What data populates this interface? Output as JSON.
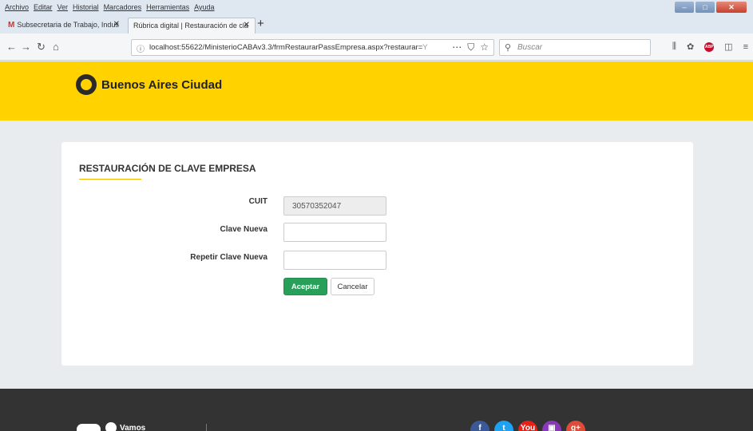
{
  "browser": {
    "menu": [
      "Archivo",
      "Editar",
      "Ver",
      "Historial",
      "Marcadores",
      "Herramientas",
      "Ayuda"
    ],
    "tabs": [
      {
        "label": "Subsecretaria de Trabajo, Indus",
        "icon": "gmail-icon"
      },
      {
        "label": "Rúbrica digital | Restauración de cla",
        "icon": ""
      }
    ],
    "url": "localhost:55622/MinisterioCABAv3.3/frmRestaurarPassEmpresa.aspx?restaurar=",
    "url_tail": "Y",
    "search_placeholder": "Buscar"
  },
  "header": {
    "logo_text": "Buenos Aires Ciudad"
  },
  "form": {
    "title": "RESTAURACIÓN DE CLAVE EMPRESA",
    "fields": [
      {
        "label": "CUIT",
        "value": "30570352047",
        "readonly": true
      },
      {
        "label": "Clave Nueva",
        "value": "",
        "readonly": false
      },
      {
        "label": "Repetir Clave Nueva",
        "value": "",
        "readonly": false
      }
    ],
    "accept_label": "Aceptar",
    "cancel_label": "Cancelar"
  },
  "footer": {
    "brand_text": "Vamos",
    "social": [
      {
        "name": "facebook-icon",
        "glyph": "f",
        "color": "#3b5998"
      },
      {
        "name": "twitter-icon",
        "glyph": "t",
        "color": "#1da1f2"
      },
      {
        "name": "youtube-icon",
        "glyph": "You",
        "color": "#e62117"
      },
      {
        "name": "instagram-icon",
        "glyph": "▣",
        "color": "#8a3ab9"
      },
      {
        "name": "googleplus-icon",
        "glyph": "g+",
        "color": "#dd4b39"
      }
    ]
  },
  "colors": {
    "header": "#ffd200",
    "accept": "#28a05a",
    "accent_underline": "#f5b400",
    "footer": "#333333"
  }
}
